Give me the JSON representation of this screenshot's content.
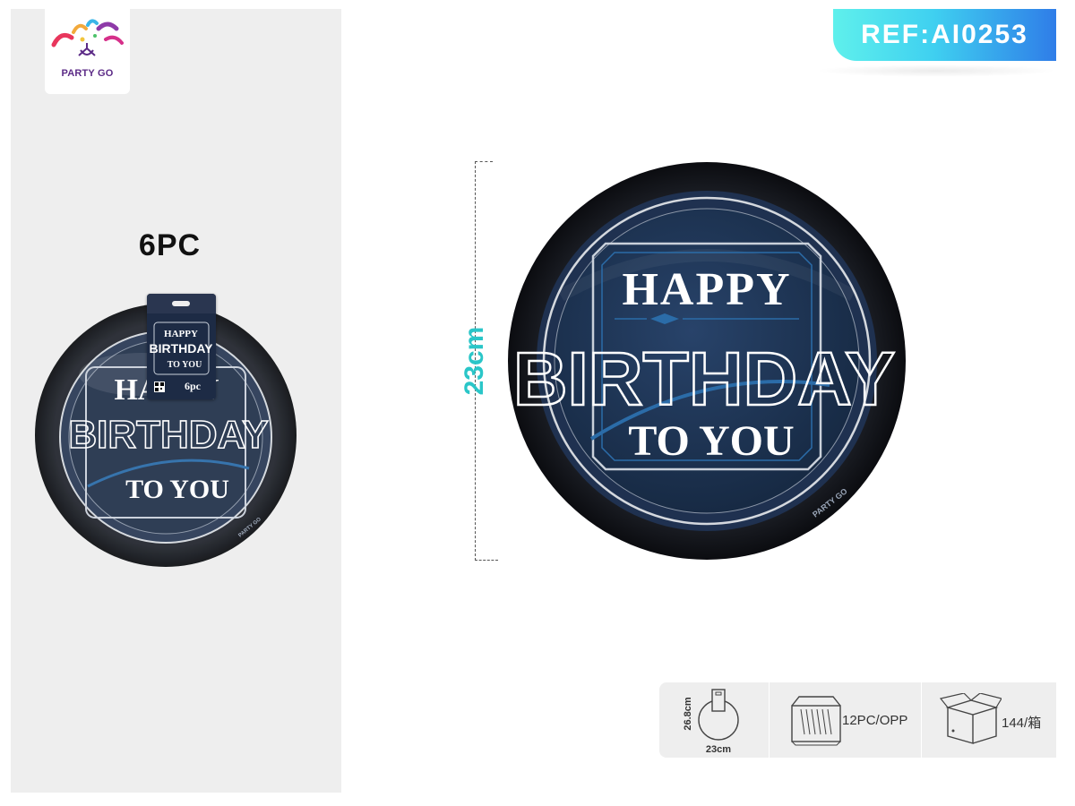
{
  "brand": {
    "logo_text": "PARTY GO"
  },
  "reference": {
    "label": "REF:AI0253"
  },
  "product": {
    "pack_quantity": "6PC",
    "plate_title_line1": "HAPPY",
    "plate_title_line2": "BIRTHDAY",
    "plate_title_line3": "TO YOU",
    "plate_brand_mark": "PARTY GO",
    "package_label": "6pc",
    "diameter_label": "23cm"
  },
  "specs": {
    "package_height": "26.8cm",
    "package_width": "23cm",
    "inner_pack": "12PC/OPP",
    "carton_qty": "144/箱"
  },
  "colors": {
    "plate_rim": "#14161c",
    "plate_center": "#1e3552",
    "accent_blue": "#2b6ca8",
    "dimension_teal": "#2ac6c8",
    "ref_gradient_start": "#5ff0ec",
    "ref_gradient_end": "#2f7de8"
  },
  "icons": {
    "logo": "party-go-logo-icon",
    "package_size": "package-dimension-icon",
    "opp_pack": "opp-bag-stack-icon",
    "carton": "carton-box-icon"
  }
}
